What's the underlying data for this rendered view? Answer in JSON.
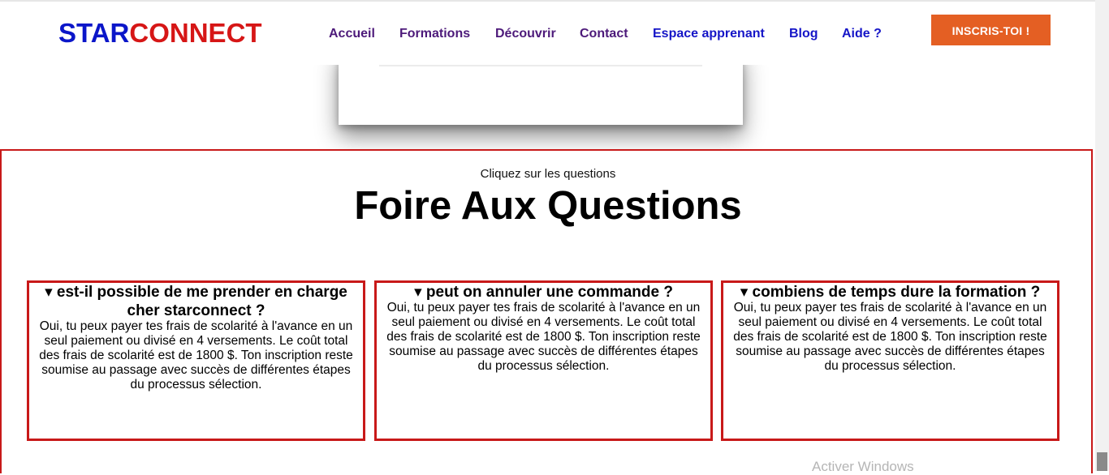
{
  "header": {
    "logo_part1": "STAR",
    "logo_part2": "CONNECT",
    "nav": [
      {
        "label": "Accueil",
        "color": "#4d1a7a"
      },
      {
        "label": "Formations",
        "color": "#4d1a7a"
      },
      {
        "label": "Découvrir",
        "color": "#4d1a7a"
      },
      {
        "label": "Contact",
        "color": "#4d1a7a"
      },
      {
        "label": "Espace apprenant",
        "color": "#1515c7"
      },
      {
        "label": "Blog",
        "color": "#1515c7"
      },
      {
        "label": "Aide ?",
        "color": "#1515c7"
      }
    ],
    "cta_label": "INSCRIS-TOI !",
    "cta_color": "#e45f23"
  },
  "faq": {
    "hint": "Cliquez sur les questions",
    "title": "Foire Aux Questions",
    "items": [
      {
        "question": "▾ est-il possible de me prender en charge cher starconnect ?",
        "answer": "Oui, tu peux payer tes frais de scolarité à l'avance en un seul paiement ou divisé en 4 versements. Le coût total des frais de scolarité est de 1800 $. Ton inscription reste soumise au passage avec succès de différentes étapes du processus sélection."
      },
      {
        "question": "▾ peut on annuler une commande ?",
        "answer": "Oui, tu peux payer tes frais de scolarité à l'avance en un seul paiement ou divisé en 4 versements. Le coût total des frais de scolarité est de 1800 $. Ton inscription reste soumise au passage avec succès de différentes étapes du processus sélection."
      },
      {
        "question": "▾ combiens de temps dure la formation ?",
        "answer": "Oui, tu peux payer tes frais de scolarité à l'avance en un seul paiement ou divisé en 4 versements. Le coût total des frais de scolarité est de 1800 $. Ton inscription reste soumise au passage avec succès de différentes étapes du processus sélection."
      }
    ],
    "border_color": "#c81919"
  },
  "overlay": {
    "watermark": "Activer Windows"
  }
}
